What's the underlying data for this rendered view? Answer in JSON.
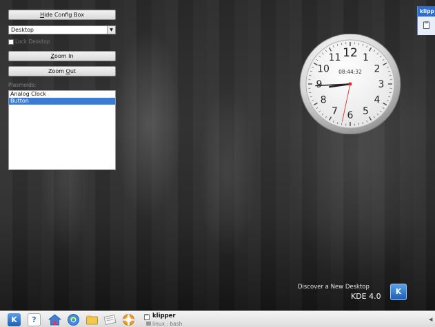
{
  "config_box": {
    "hide_button_pre": "",
    "hide_button_u": "H",
    "hide_button_post": "ide Config Box",
    "layout_value": "Desktop",
    "lock_label": "Lock Desktop",
    "zoom_in_u": "Z",
    "zoom_in_post": "oom In",
    "zoom_out_pre": "Zoom ",
    "zoom_out_u": "O",
    "zoom_out_post": "ut",
    "plasmoids_label": "Plasmoids:",
    "plasmoids": [
      "Analog Clock",
      "Button"
    ],
    "selected_plasmoid": "Button"
  },
  "clock": {
    "digital_time": "08:44:32",
    "numerals": [
      "12",
      "1",
      "2",
      "3",
      "4",
      "5",
      "6",
      "7",
      "8",
      "9",
      "10",
      "11"
    ],
    "hours": 8,
    "minutes": 44,
    "seconds": 32
  },
  "branding": {
    "discover": "Discover a New Desktop",
    "version": "KDE 4.0",
    "badge": "K"
  },
  "klipper_widget": {
    "title": "klipp"
  },
  "panel": {
    "task_title": "klipper",
    "task_subtitle": "linux : bash",
    "start_icon": "K",
    "help_icon": "?"
  },
  "colors": {
    "selection": "#3a7bd5",
    "kde_blue": "#2d6fd0",
    "second_hand": "#d8302a"
  }
}
